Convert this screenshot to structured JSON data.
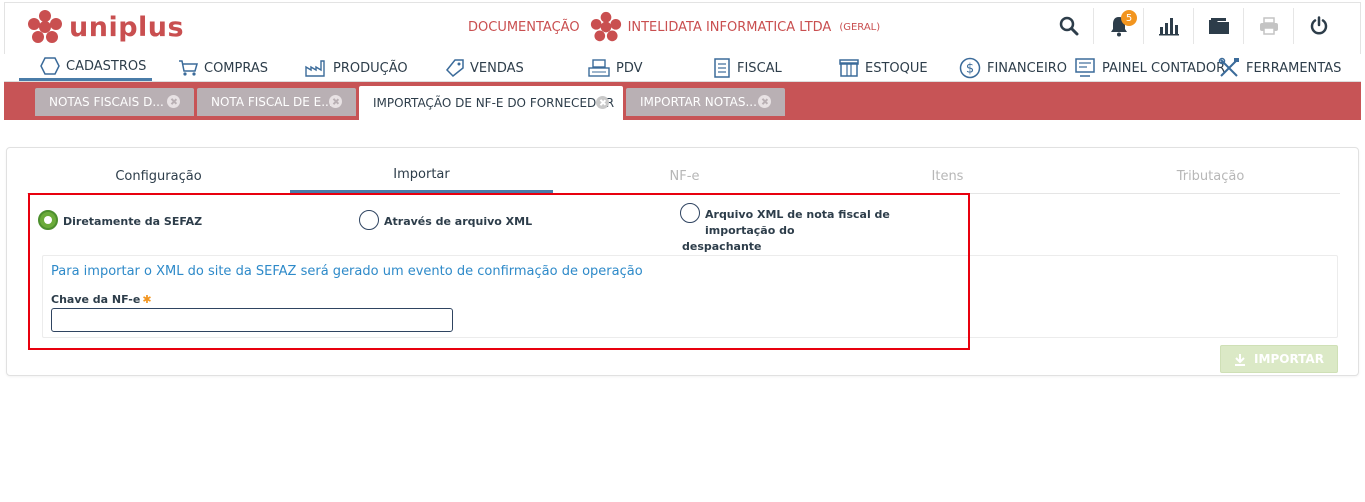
{
  "brand": {
    "name": "uniplus",
    "color": "#c94f50"
  },
  "company": {
    "doc_label": "DOCUMENTAÇÃO",
    "name": "INTELIDATA INFORMATICA LTDA",
    "scope": "(GERAL)"
  },
  "toolbar": {
    "notifications_count": "5",
    "icons": [
      "search-icon",
      "bell-icon",
      "chart-icon",
      "folder-icon",
      "printer-icon",
      "power-icon"
    ]
  },
  "menu": {
    "items": [
      {
        "label": "CADASTROS",
        "icon": "hexagon-icon",
        "active": true
      },
      {
        "label": "COMPRAS",
        "icon": "cart-icon"
      },
      {
        "label": "PRODUÇÃO",
        "icon": "factory-icon"
      },
      {
        "label": "VENDAS",
        "icon": "tag-icon"
      },
      {
        "label": "PDV",
        "icon": "register-icon"
      },
      {
        "label": "FISCAL",
        "icon": "document-icon"
      },
      {
        "label": "ESTOQUE",
        "icon": "box-icon"
      },
      {
        "label": "FINANCEIRO",
        "icon": "dollar-icon"
      },
      {
        "label": "PAINEL CONTADOR",
        "icon": "monitor-icon"
      },
      {
        "label": "FERRAMENTAS",
        "icon": "tools-icon"
      }
    ]
  },
  "tabs": [
    {
      "label": "NOTAS FISCAIS D..."
    },
    {
      "label": "NOTA FISCAL DE E..."
    },
    {
      "label": "IMPORTAÇÃO DE NF-E DO FORNECEDOR",
      "active": true
    },
    {
      "label": "IMPORTAR NOTAS..."
    }
  ],
  "wizard": {
    "steps": [
      {
        "label": "Configuração",
        "state": "normal"
      },
      {
        "label": "Importar",
        "state": "active"
      },
      {
        "label": "NF-e",
        "state": "disabled"
      },
      {
        "label": "Itens",
        "state": "disabled"
      },
      {
        "label": "Tributação",
        "state": "disabled"
      }
    ]
  },
  "source_options": [
    {
      "label": "Diretamente da SEFAZ",
      "checked": true
    },
    {
      "label": "Através de arquivo XML",
      "checked": false
    },
    {
      "label_line1": "Arquivo XML de nota fiscal de importação do",
      "label_line2": "despachante",
      "checked": false
    }
  ],
  "form": {
    "info": "Para importar o XML do site da SEFAZ será gerado um evento de confirmação de operação",
    "key_label": "Chave da NF-e",
    "required_mark": "✱",
    "key_value": ""
  },
  "actions": {
    "import_label": "IMPORTAR"
  },
  "colors": {
    "accent": "#4a7ca8",
    "tabbar": "#c75456",
    "highlight": "#e8000e",
    "info": "#2e8ac9",
    "check": "#6bab3a"
  }
}
